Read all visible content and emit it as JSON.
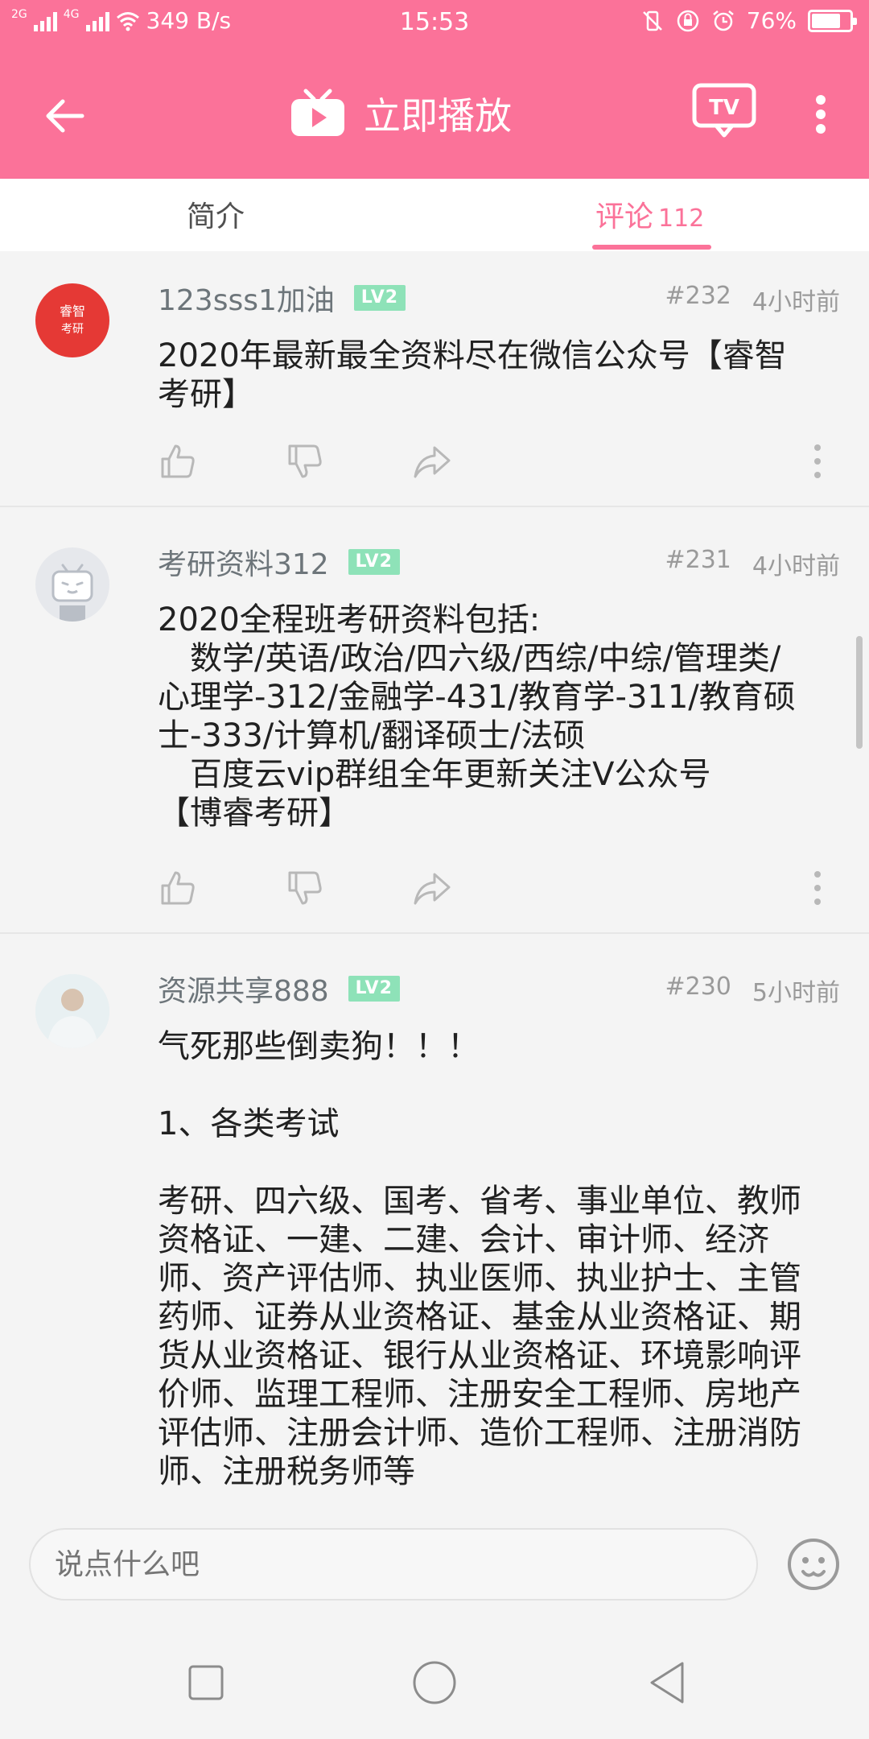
{
  "status_bar": {
    "net_left": "2G",
    "net_right": "4G",
    "speed": "349 B/s",
    "time": "15:53",
    "battery": "76%",
    "battery_level": 0.76
  },
  "app_bar": {
    "title": "立即播放",
    "tv_label": "TV"
  },
  "tabs": {
    "intro": "简介",
    "comments": "评论",
    "comment_count": "112"
  },
  "comments": [
    {
      "user": "123sss1加油",
      "level": "LV2",
      "floor": "#232",
      "time": "4小时前",
      "avatar_text": [
        "睿智",
        "考研"
      ],
      "lines": [
        "2020年最新最全资料尽在微信公众号【睿智",
        "考研】"
      ]
    },
    {
      "user": "考研资料312",
      "level": "LV2",
      "floor": "#231",
      "time": "4小时前",
      "lines": [
        "2020全程班考研资料包括:",
        "　数学/英语/政治/四六级/西综/中综/管理类/",
        "心理学-312/金融学-431/教育学-311/教育硕",
        "士-333/计算机/翻译硕士/法硕",
        "　百度云vip群组全年更新关注V公众号",
        "【博睿考研】"
      ]
    },
    {
      "user": "资源共享888",
      "level": "LV2",
      "floor": "#230",
      "time": "5小时前",
      "lines": [
        "气死那些倒卖狗！！！",
        "",
        "1、各类考试",
        "",
        "考研、四六级、国考、省考、事业单位、教师",
        "资格证、一建、二建、会计、审计师、经济",
        "师、资产评估师、执业医师、执业护士、主管",
        "药师、证券从业资格证、基金从业资格证、期",
        "货从业资格证、银行从业资格证、环境影响评",
        "价师、监理工程师、注册安全工程师、房地产",
        "评估师、注册会计师、造价工程师、注册消防",
        "师、注册税务师等"
      ]
    }
  ],
  "input": {
    "placeholder": "说点什么吧"
  },
  "colors": {
    "brand_pink": "#fb7299",
    "level_green": "#8ee2b8",
    "text_gray": "#6d757a"
  },
  "icons": [
    "back-arrow-icon",
    "tv-play-icon",
    "cast-tv-icon",
    "more-vertical-icon",
    "like-icon",
    "dislike-icon",
    "share-icon",
    "emoji-icon"
  ]
}
